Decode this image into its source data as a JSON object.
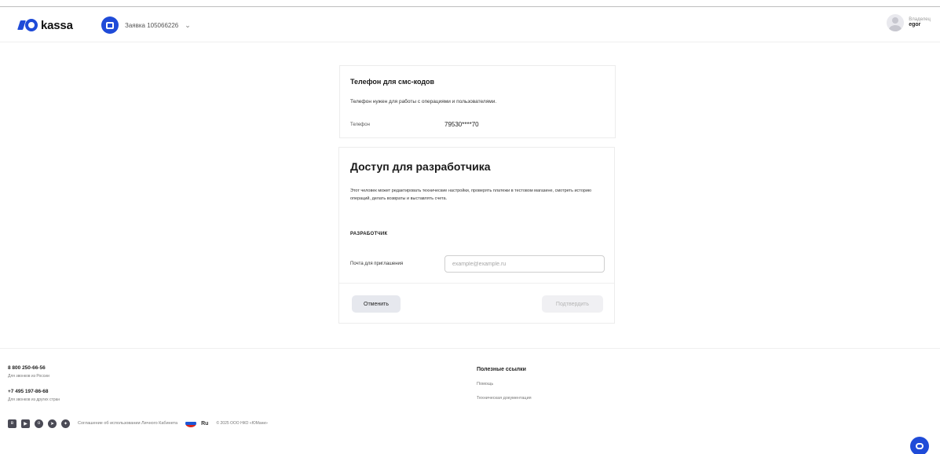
{
  "header": {
    "logo_text": "kassa",
    "shop_label": "Заявка 105066226",
    "user_role": "Владелец",
    "user_name": "egor"
  },
  "phone_card": {
    "title": "Телефон для смс-кодов",
    "description": "Телефон нужен для работы с операциями и пользователями.",
    "phone_label": "Телефон",
    "phone_value": "79530****70"
  },
  "developer_card": {
    "title": "Доступ для разработчика",
    "description": "Этот человек может редактировать технические настройки, проверять платежи в тестовом магазине, смотреть историю операций, делать возвраты и выставлять счета.",
    "section_label": "РАЗРАБОТЧИК",
    "email_label": "Почта для приглашения",
    "email_placeholder": "example@example.ru",
    "email_value": "",
    "cancel_label": "Отменить",
    "confirm_label": "Подтвердить"
  },
  "footer": {
    "phone_russia": "8 800 250-66-56",
    "phone_russia_note": "Для звонков из России",
    "phone_other": "+7 495 197-86-68",
    "phone_other_note": "Для звонков из других стран",
    "links_title": "Полезные ссылки",
    "links": [
      "Помощь",
      "Техническая документация"
    ],
    "agreement": "Соглашение об использовании Личного Кабинета",
    "language": "Ru",
    "copyright": "© 2025 ООО НКО «ЮMани»",
    "social_icons": [
      "vk-icon",
      "youtube-icon",
      "odnoklassniki-icon",
      "telegram-icon",
      "dzen-icon"
    ]
  },
  "colors": {
    "brand": "#1f4bd8",
    "cancel_bg": "#e6e8ee",
    "confirm_bg_disabled": "#f0f0f3"
  }
}
